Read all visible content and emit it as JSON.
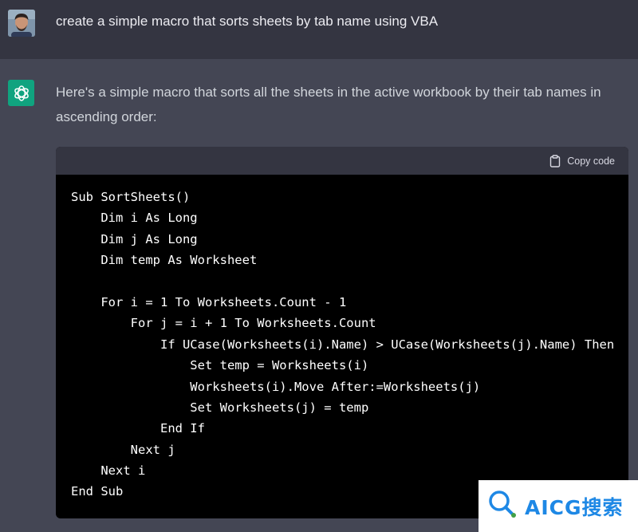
{
  "user_message": {
    "avatar": "user-avatar",
    "text": "create a simple macro that sorts sheets by tab name using VBA"
  },
  "assistant_message": {
    "icon": "openai-logo-icon",
    "intro": "Here's a simple macro that sorts all the sheets in the active workbook by their tab names in ascending order:"
  },
  "code_block": {
    "copy_label": "Copy code",
    "copy_icon": "clipboard-icon",
    "lines": [
      "Sub SortSheets()",
      "    Dim i As Long",
      "    Dim j As Long",
      "    Dim temp As Worksheet",
      "",
      "    For i = 1 To Worksheets.Count - 1",
      "        For j = i + 1 To Worksheets.Count",
      "            If UCase(Worksheets(i).Name) > UCase(Worksheets(j).Name) Then",
      "                Set temp = Worksheets(i)",
      "                Worksheets(i).Move After:=Worksheets(j)",
      "                Set Worksheets(j) = temp",
      "            End If",
      "        Next j",
      "    Next i",
      "End Sub"
    ]
  },
  "watermark": {
    "text": "AICG搜索",
    "icon": "magnifier-logo-icon"
  },
  "colors": {
    "user_bg": "#343541",
    "assistant_bg": "#444654",
    "code_bg": "#000000",
    "accent": "#10a37f",
    "watermark": "#1e88e5"
  }
}
